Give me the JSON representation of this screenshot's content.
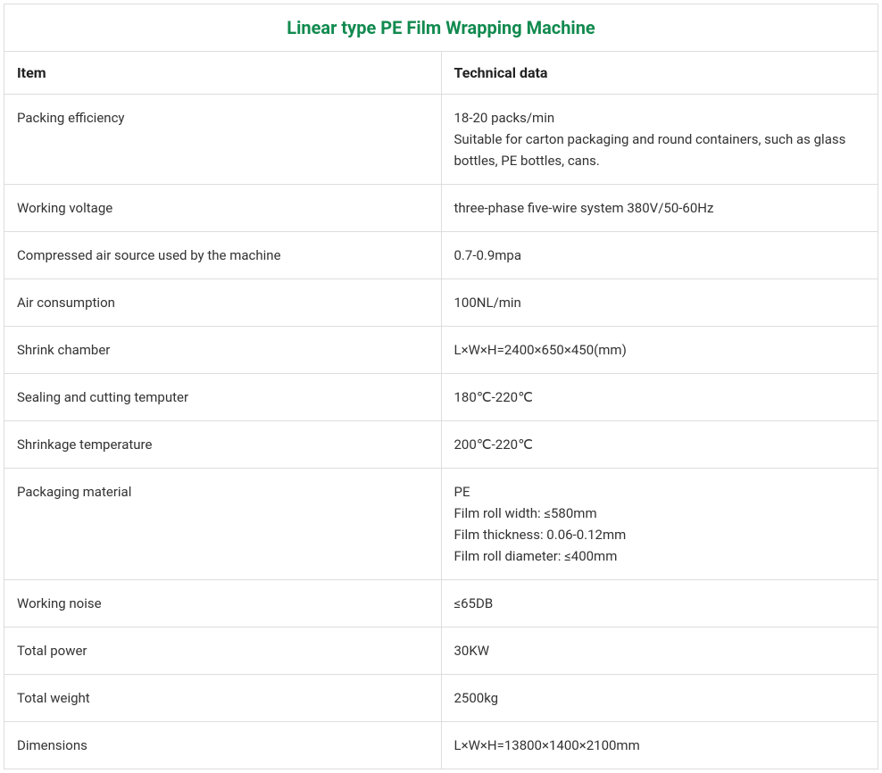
{
  "title": "Linear type PE Film Wrapping Machine",
  "headers": {
    "item": "Item",
    "data": "Technical data"
  },
  "rows": [
    {
      "item": "Packing efficiency",
      "data": "18-20 packs/min\nSuitable for carton packaging and round containers, such as glass bottles, PE bottles, cans."
    },
    {
      "item": "Working voltage",
      "data": "three-phase five-wire system 380V/50-60Hz"
    },
    {
      "item": "Compressed air source used by the machine",
      "data": "0.7-0.9mpa"
    },
    {
      "item": "Air consumption",
      "data": "100NL/min"
    },
    {
      "item": "Shrink chamber",
      "data": "L×W×H=2400×650×450(mm)"
    },
    {
      "item": "Sealing and cutting temputer",
      "data": "180℃-220℃"
    },
    {
      "item": "Shrinkage temperature",
      "data": "200℃-220℃"
    },
    {
      "item": "Packaging material",
      "data": "PE\nFilm roll width: ≤580mm\nFilm thickness: 0.06-0.12mm\nFilm roll diameter: ≤400mm"
    },
    {
      "item": "Working noise",
      "data": "≤65DB"
    },
    {
      "item": "Total power",
      "data": "30KW"
    },
    {
      "item": "Total weight",
      "data": "2500kg"
    },
    {
      "item": "Dimensions",
      "data": "L×W×H=13800×1400×2100mm"
    }
  ]
}
